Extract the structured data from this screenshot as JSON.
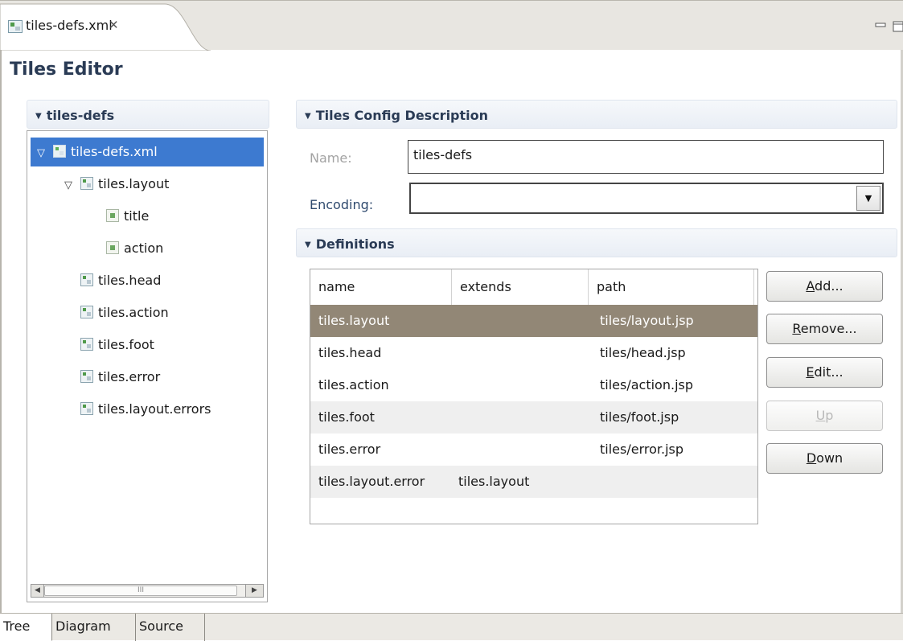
{
  "editor_tab": {
    "label": "tiles-defs.xml",
    "close_glyph": "✕",
    "icon": "tiles-file-icon"
  },
  "window_controls": {
    "minimize": "minimize-icon",
    "maximize": "maximize-icon"
  },
  "editor_title": "Tiles Editor",
  "tree_section": {
    "header": "tiles-defs",
    "nodes": [
      {
        "label": "tiles-defs.xml",
        "icon": "tiles-file-icon",
        "expanded": true,
        "selected": true
      },
      {
        "label": "tiles.layout",
        "icon": "definition-icon",
        "expanded": true
      },
      {
        "label": "title",
        "icon": "attribute-icon"
      },
      {
        "label": "action",
        "icon": "attribute-icon"
      },
      {
        "label": "tiles.head",
        "icon": "definition-icon"
      },
      {
        "label": "tiles.action",
        "icon": "definition-icon"
      },
      {
        "label": "tiles.foot",
        "icon": "definition-icon"
      },
      {
        "label": "tiles.error",
        "icon": "definition-icon"
      },
      {
        "label": "tiles.layout.errors",
        "icon": "definition-icon"
      }
    ],
    "scroll_thumb_grip": "III"
  },
  "config_section": {
    "header": "Tiles Config Description",
    "name_label": "Name:",
    "name_value": "tiles-defs",
    "encoding_label": "Encoding:",
    "encoding_value": ""
  },
  "definitions_section": {
    "header": "Definitions",
    "columns": [
      "name",
      "extends",
      "path"
    ],
    "rows": [
      {
        "name": "tiles.layout",
        "extends": "",
        "path": "tiles/layout.jsp",
        "selected": true
      },
      {
        "name": "tiles.head",
        "extends": "",
        "path": "tiles/head.jsp"
      },
      {
        "name": "tiles.action",
        "extends": "",
        "path": "tiles/action.jsp"
      },
      {
        "name": "tiles.foot",
        "extends": "",
        "path": "tiles/foot.jsp"
      },
      {
        "name": "tiles.error",
        "extends": "",
        "path": "tiles/error.jsp"
      },
      {
        "name": "tiles.layout.error",
        "extends": "tiles.layout",
        "path": ""
      }
    ],
    "buttons": {
      "add": {
        "mnemonic": "A",
        "rest": "dd..."
      },
      "remove": {
        "mnemonic": "R",
        "rest": "emove..."
      },
      "edit": {
        "mnemonic": "E",
        "rest": "dit..."
      },
      "up": {
        "mnemonic": "U",
        "rest": "p",
        "disabled": true
      },
      "down": {
        "mnemonic": "D",
        "rest": "own"
      }
    }
  },
  "bottom_tabs": [
    "Tree",
    "Diagram",
    "Source"
  ],
  "colors": {
    "selection_tree": "#3d7ad0",
    "selection_table": "#928776",
    "title_text": "#2a3b55"
  }
}
